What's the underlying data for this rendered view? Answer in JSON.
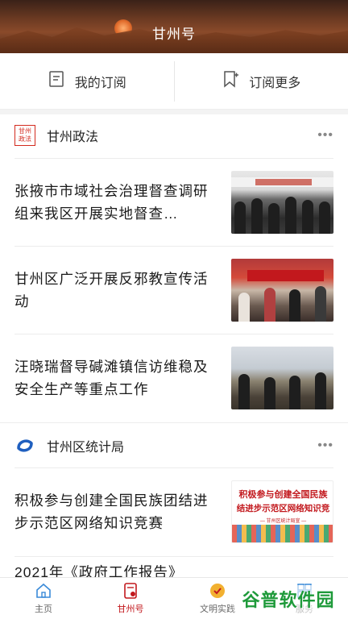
{
  "header": {
    "title": "甘州号"
  },
  "subscription": {
    "mine_label": "我的订阅",
    "more_label": "订阅更多"
  },
  "channels": [
    {
      "name": "甘州政法",
      "logo_text": "甘州政法",
      "more": "•••",
      "articles": [
        {
          "title": "张掖市市域社会治理督查调研组来我区开展实地督查…",
          "thumb_text": ""
        },
        {
          "title": "甘州区广泛开展反邪教宣传活动",
          "thumb_text": ""
        },
        {
          "title": "汪晓瑞督导碱滩镇信访维稳及安全生产等重点工作",
          "thumb_text": ""
        }
      ]
    },
    {
      "name": "甘州区统计局",
      "more": "•••",
      "articles": [
        {
          "title": "积极参与创建全国民族团结进步示范区网络知识竞赛",
          "thumb_line1": "积极参与创建全国民族",
          "thumb_line2": "结进步示范区网络知识竞",
          "thumb_line3": "— 甘州区统计局宣 —"
        },
        {
          "title": "2021年《政府工作报告》"
        }
      ]
    }
  ],
  "tabbar": {
    "items": [
      {
        "label": "主页",
        "icon": "home-icon"
      },
      {
        "label": "甘州号",
        "icon": "document-icon",
        "active": true
      },
      {
        "label": "文明实践",
        "icon": "badge-icon"
      },
      {
        "label": "服务",
        "icon": "grid-icon"
      }
    ]
  },
  "watermark": "谷普软件园",
  "colors": {
    "accent": "#c2181d",
    "logo_blue": "#1f5fbf",
    "text": "#1a1a1a"
  }
}
